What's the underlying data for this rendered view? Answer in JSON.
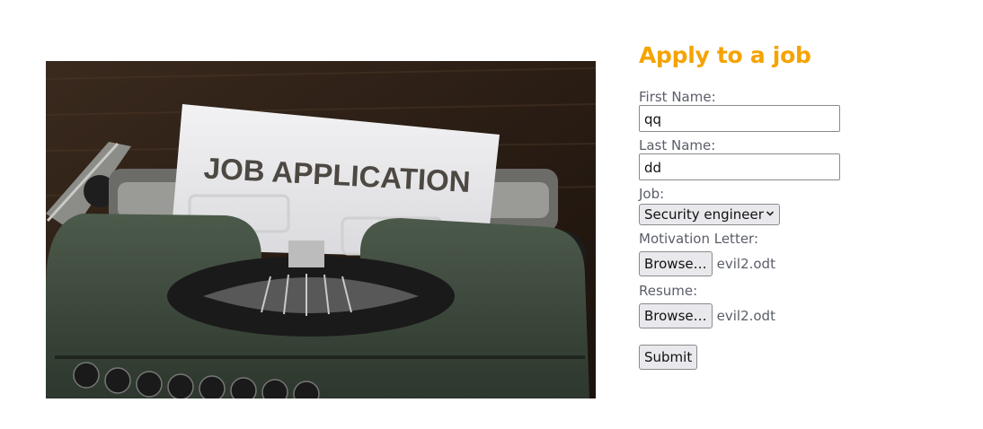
{
  "hero": {
    "paper_text": "JOB APPLICATION"
  },
  "form": {
    "title": "Apply to a job",
    "first_name": {
      "label": "First Name:",
      "value": "qq"
    },
    "last_name": {
      "label": "Last Name:",
      "value": "dd"
    },
    "job": {
      "label": "Job:",
      "selected": "Security engineer"
    },
    "motivation": {
      "label": "Motivation Letter:",
      "browse": "Browse…",
      "file": "evil2.odt"
    },
    "resume": {
      "label": "Resume:",
      "browse": "Browse…",
      "file": "evil2.odt"
    },
    "submit": "Submit"
  },
  "colors": {
    "title": "#f5a300",
    "label": "#5a5e68",
    "button_bg": "#e9e9ed"
  },
  "icons": {
    "select_arrow": "chevron-down-icon"
  }
}
